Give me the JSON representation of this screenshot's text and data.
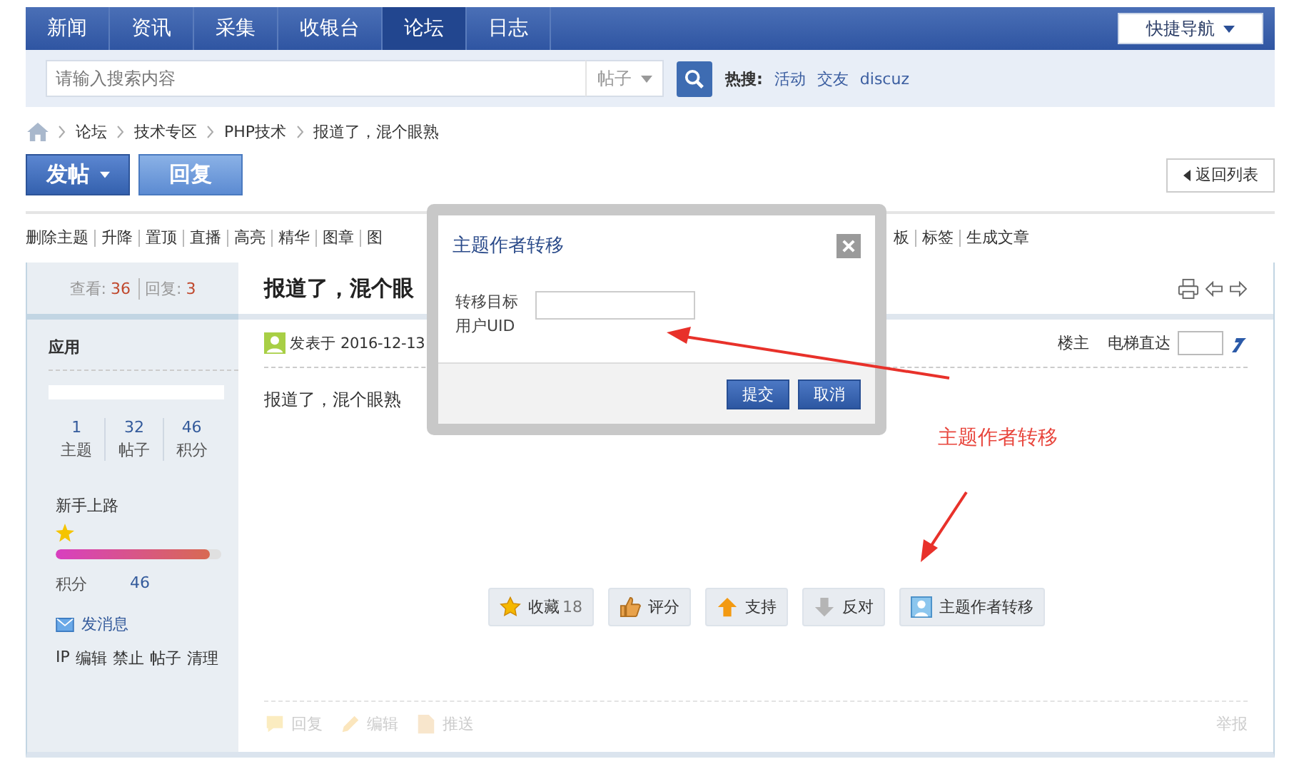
{
  "nav": {
    "items": [
      {
        "label": "新闻",
        "selected": false
      },
      {
        "label": "资讯",
        "selected": false
      },
      {
        "label": "采集",
        "selected": false
      },
      {
        "label": "收银台",
        "selected": false
      },
      {
        "label": "论坛",
        "selected": true
      },
      {
        "label": "日志",
        "selected": false
      }
    ],
    "quick_nav": "快捷导航"
  },
  "search": {
    "placeholder": "请输入搜索内容",
    "scope": "帖子",
    "hot_label": "热搜:",
    "hot": [
      "活动",
      "交友",
      "discuz"
    ]
  },
  "breadcrumb": [
    "论坛",
    "技术专区",
    "PHP技术",
    "报道了，混个眼熟"
  ],
  "actions": {
    "post": "发帖",
    "reply": "回复",
    "back": "返回列表"
  },
  "admin_links_left": [
    "删除主题",
    "升降",
    "置顶",
    "直播",
    "高亮",
    "精华",
    "图章",
    "图"
  ],
  "admin_links_right": [
    "板",
    "标签",
    "生成文章"
  ],
  "sidebar": {
    "views_label": "查看:",
    "views": "36",
    "replies_label": "回复:",
    "replies": "3",
    "section": "应用",
    "stats": [
      {
        "value": "1",
        "label": "主题"
      },
      {
        "value": "32",
        "label": "帖子"
      },
      {
        "value": "46",
        "label": "积分"
      }
    ],
    "rank": "新手上路",
    "level": 0.93,
    "points_label": "积分",
    "points": "46",
    "message": "发消息",
    "tools": [
      "IP",
      "编辑",
      "禁止",
      "帖子",
      "清理"
    ]
  },
  "post": {
    "title": "报道了，混个眼",
    "posted": "发表于 2016-12-13",
    "op": "楼主",
    "jump": "电梯直达",
    "body": "报道了，混个眼熟",
    "buttons": [
      {
        "kind": "favorite",
        "label": "收藏",
        "count": "18"
      },
      {
        "kind": "rate",
        "label": "评分"
      },
      {
        "kind": "support",
        "label": "支持"
      },
      {
        "kind": "oppose",
        "label": "反对"
      },
      {
        "kind": "transfer",
        "label": "主题作者转移"
      }
    ],
    "footer": [
      {
        "kind": "reply",
        "label": "回复"
      },
      {
        "kind": "edit",
        "label": "编辑"
      },
      {
        "kind": "push",
        "label": "推送"
      }
    ],
    "report": "举报"
  },
  "dialog": {
    "title": "主题作者转移",
    "field_label": [
      "转移目标",
      "用户UID"
    ],
    "submit": "提交",
    "cancel": "取消"
  },
  "annotation": {
    "text": "主题作者转移"
  }
}
